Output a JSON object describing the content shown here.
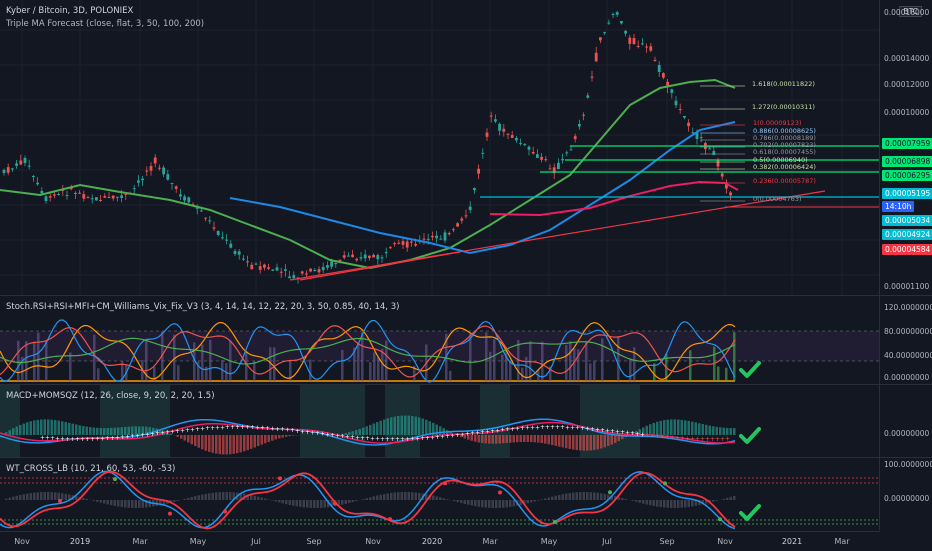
{
  "header": {
    "title": "Kyber / Bitcoin, 3D, POLONIEX",
    "indicator": "Triple MA Forecast (close, flat, 3, 50, 100, 200)",
    "currency": "BTC"
  },
  "price_axis": {
    "ticks": [
      "0.00016000",
      "0.00014000",
      "0.00012000",
      "0.00010000",
      "0.00001100"
    ],
    "labels": [
      {
        "text": "0.00007959",
        "color": "#00e676"
      },
      {
        "text": "0.00006898",
        "color": "#00e676"
      },
      {
        "text": "0.00006295",
        "color": "#00e676"
      },
      {
        "text": "0.00005195",
        "color": "#00bcd4"
      },
      {
        "text": "14:10h",
        "color": "#2962ff"
      },
      {
        "text": "0.00005034",
        "color": "#00bcd4"
      },
      {
        "text": "0.00004924",
        "color": "#00bcd4"
      },
      {
        "text": "0.00004584",
        "color": "#f23645"
      }
    ]
  },
  "fib_levels": [
    {
      "text": "1.618(0.00011822)",
      "color": "#c5e1a5"
    },
    {
      "text": "1.272(0.00010311)",
      "color": "#c5e1a5"
    },
    {
      "text": "1(0.00009123)",
      "color": "#f23645"
    },
    {
      "text": "0.886(0.00008625)",
      "color": "#90caf9"
    },
    {
      "text": "0.786(0.00008189)",
      "color": "#9598a1"
    },
    {
      "text": "0.702(0.00007823)",
      "color": "#9598a1"
    },
    {
      "text": "0.618(0.00007455)",
      "color": "#9598a1"
    },
    {
      "text": "0.5(0.00006940)",
      "color": "#c5e1a5"
    },
    {
      "text": "0.382(0.00006424)",
      "color": "#c5e1a5"
    },
    {
      "text": "0.236(0.00005787)",
      "color": "#f23645"
    },
    {
      "text": "0(0.00004763)",
      "color": "#9598a1"
    }
  ],
  "panes": {
    "stoch": {
      "title": "Stoch.RSI+RSI+MFI+CM_Williams_Vix_Fix_V3 (3, 4, 14, 14, 12, 22, 20, 3, 50, 0.85, 40, 14, 3)",
      "ticks": [
        "120.00000000",
        "80.00000000",
        "40.00000000",
        "0.00000000"
      ]
    },
    "macd": {
      "title": "MACD+MOMSQZ (12, 26, close, 9, 20, 2, 20, 1.5)",
      "ticks": [
        "0.00000000"
      ]
    },
    "wt": {
      "title": "WT_CROSS_LB (10, 21, 60, 53, -60, -53)",
      "ticks": [
        "100.00000000",
        "0.00000000"
      ]
    }
  },
  "time_axis": [
    "Nov",
    "2019",
    "Mar",
    "May",
    "Jul",
    "Sep",
    "Nov",
    "2020",
    "Mar",
    "May",
    "Jul",
    "Sep",
    "Nov",
    "2021",
    "Mar"
  ],
  "colors": {
    "background": "#131722",
    "up": "#26a69a",
    "down": "#ef5350",
    "ma50": "#4caf50",
    "ma100": "#1e88e5",
    "ma200": "#e91e63",
    "check": "#22c55e"
  }
}
